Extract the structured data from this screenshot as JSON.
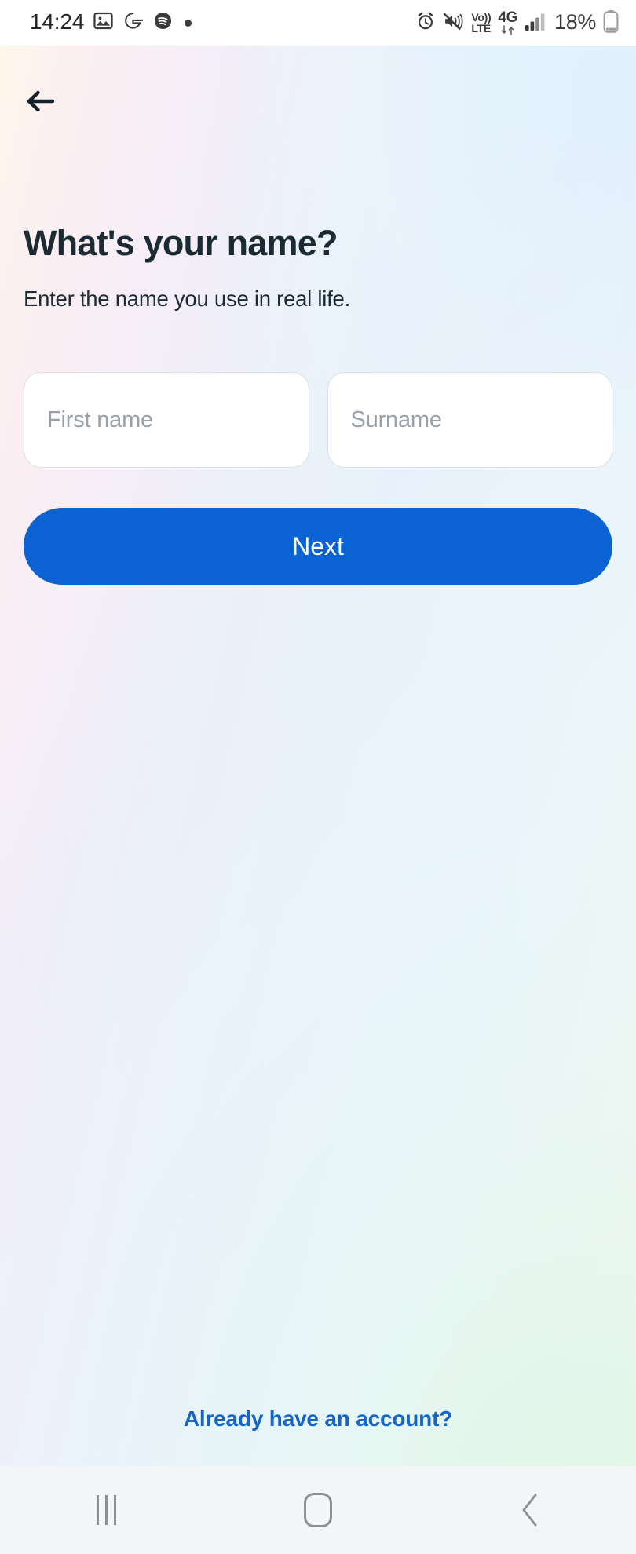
{
  "statusbar": {
    "time": "14:24",
    "left_icons": [
      {
        "name": "gallery-icon",
        "label": "gallery"
      },
      {
        "name": "google-icon",
        "label": "G"
      },
      {
        "name": "spotify-icon",
        "label": "spotify"
      },
      {
        "name": "notification-dot-icon",
        "label": "dot"
      }
    ],
    "right_icons": [
      {
        "name": "alarm-icon",
        "label": "alarm"
      },
      {
        "name": "mute-icon",
        "label": "sound off"
      }
    ],
    "volte_top": "Vo))",
    "volte_bottom": "LTE",
    "network": "4G",
    "battery_percent": "18%"
  },
  "header": {
    "back_label": "Back",
    "title": "What's your name?",
    "subtitle": "Enter the name you use in real life."
  },
  "form": {
    "first_name": {
      "value": "",
      "placeholder": "First name"
    },
    "surname": {
      "value": "",
      "placeholder": "Surname"
    },
    "submit_label": "Next"
  },
  "footer": {
    "account_link": "Already have an account?"
  },
  "navbar": {
    "recents_label": "Recents",
    "home_label": "Home",
    "back_label": "Back"
  },
  "colors": {
    "primary_button": "#0b63d3",
    "link": "#1565c9",
    "title_text": "#1c2b33",
    "placeholder": "#9aa0a6",
    "field_border": "#dcdfe3",
    "navbar_bg": "#f4f5f6"
  }
}
